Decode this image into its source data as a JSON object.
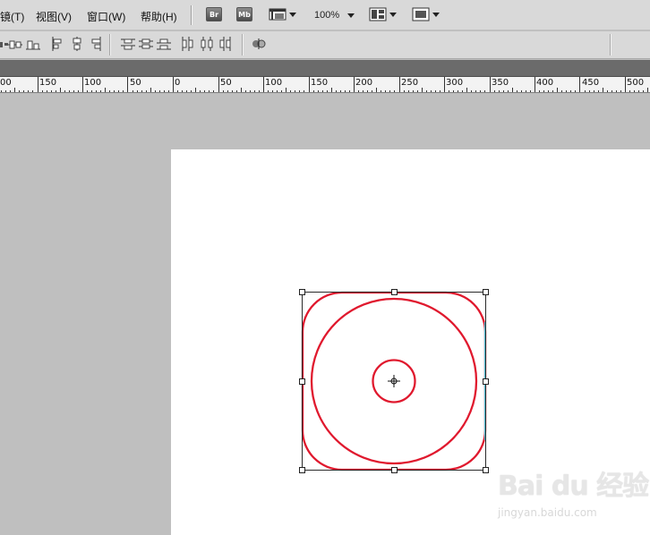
{
  "menu": {
    "items": [
      {
        "label": "镜(T)"
      },
      {
        "label": "视图(V)"
      },
      {
        "label": "窗口(W)"
      },
      {
        "label": "帮助(H)"
      }
    ],
    "bridge_label": "Br",
    "minibridge_label": "Mb",
    "zoom": "100%"
  },
  "ruler": {
    "labels": [
      "00",
      "150",
      "100",
      "50",
      "0",
      "50",
      "100",
      "150",
      "200",
      "250",
      "300",
      "350",
      "400",
      "450",
      "500"
    ]
  },
  "watermark": {
    "brand": "Bai du 经验",
    "url": "jingyan.baidu.com"
  },
  "colors": {
    "shape_stroke": "#e0192e",
    "path_outline": "#2a2a2a",
    "canvas": "#ffffff",
    "pasteboard": "#bfbfbf",
    "menubar": "#d9d9d9"
  }
}
